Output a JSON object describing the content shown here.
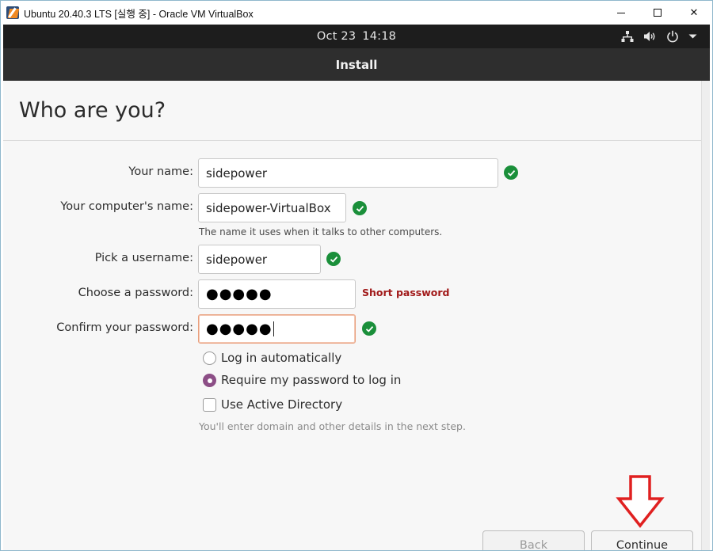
{
  "window": {
    "title": "Ubuntu 20.40.3 LTS [실행 중] - Oracle VM VirtualBox",
    "minimize_icon": "minimize-icon",
    "maximize_icon": "maximize-icon",
    "close_label": "✕"
  },
  "topbar": {
    "date": "Oct 23",
    "time": "14:18",
    "icons": [
      "network-icon",
      "volume-icon",
      "power-icon",
      "dropdown-arrow-icon"
    ]
  },
  "header": {
    "title": "Install"
  },
  "page": {
    "title": "Who are you?"
  },
  "form": {
    "name": {
      "label": "Your name:",
      "value": "sidepower"
    },
    "computer": {
      "label": "Your computer's name:",
      "value": "sidepower-VirtualBox",
      "hint": "The name it uses when it talks to other computers."
    },
    "username": {
      "label": "Pick a username:",
      "value": "sidepower"
    },
    "password": {
      "label": "Choose a password:",
      "value": "●●●●●",
      "warning": "Short password"
    },
    "confirm": {
      "label": "Confirm your password:",
      "value": "●●●●●"
    },
    "login_auto": {
      "label": "Log in automatically",
      "selected": false
    },
    "login_require": {
      "label": "Require my password to log in",
      "selected": true
    },
    "active_directory": {
      "label": "Use Active Directory",
      "checked": false,
      "hint": "You'll enter domain and other details in the next step."
    }
  },
  "buttons": {
    "back": "Back",
    "continue": "Continue"
  },
  "colors": {
    "accent": "#8c4e86",
    "ok": "#1a8f3a",
    "warning": "#a11a1a",
    "annotation_arrow": "#e02020"
  }
}
